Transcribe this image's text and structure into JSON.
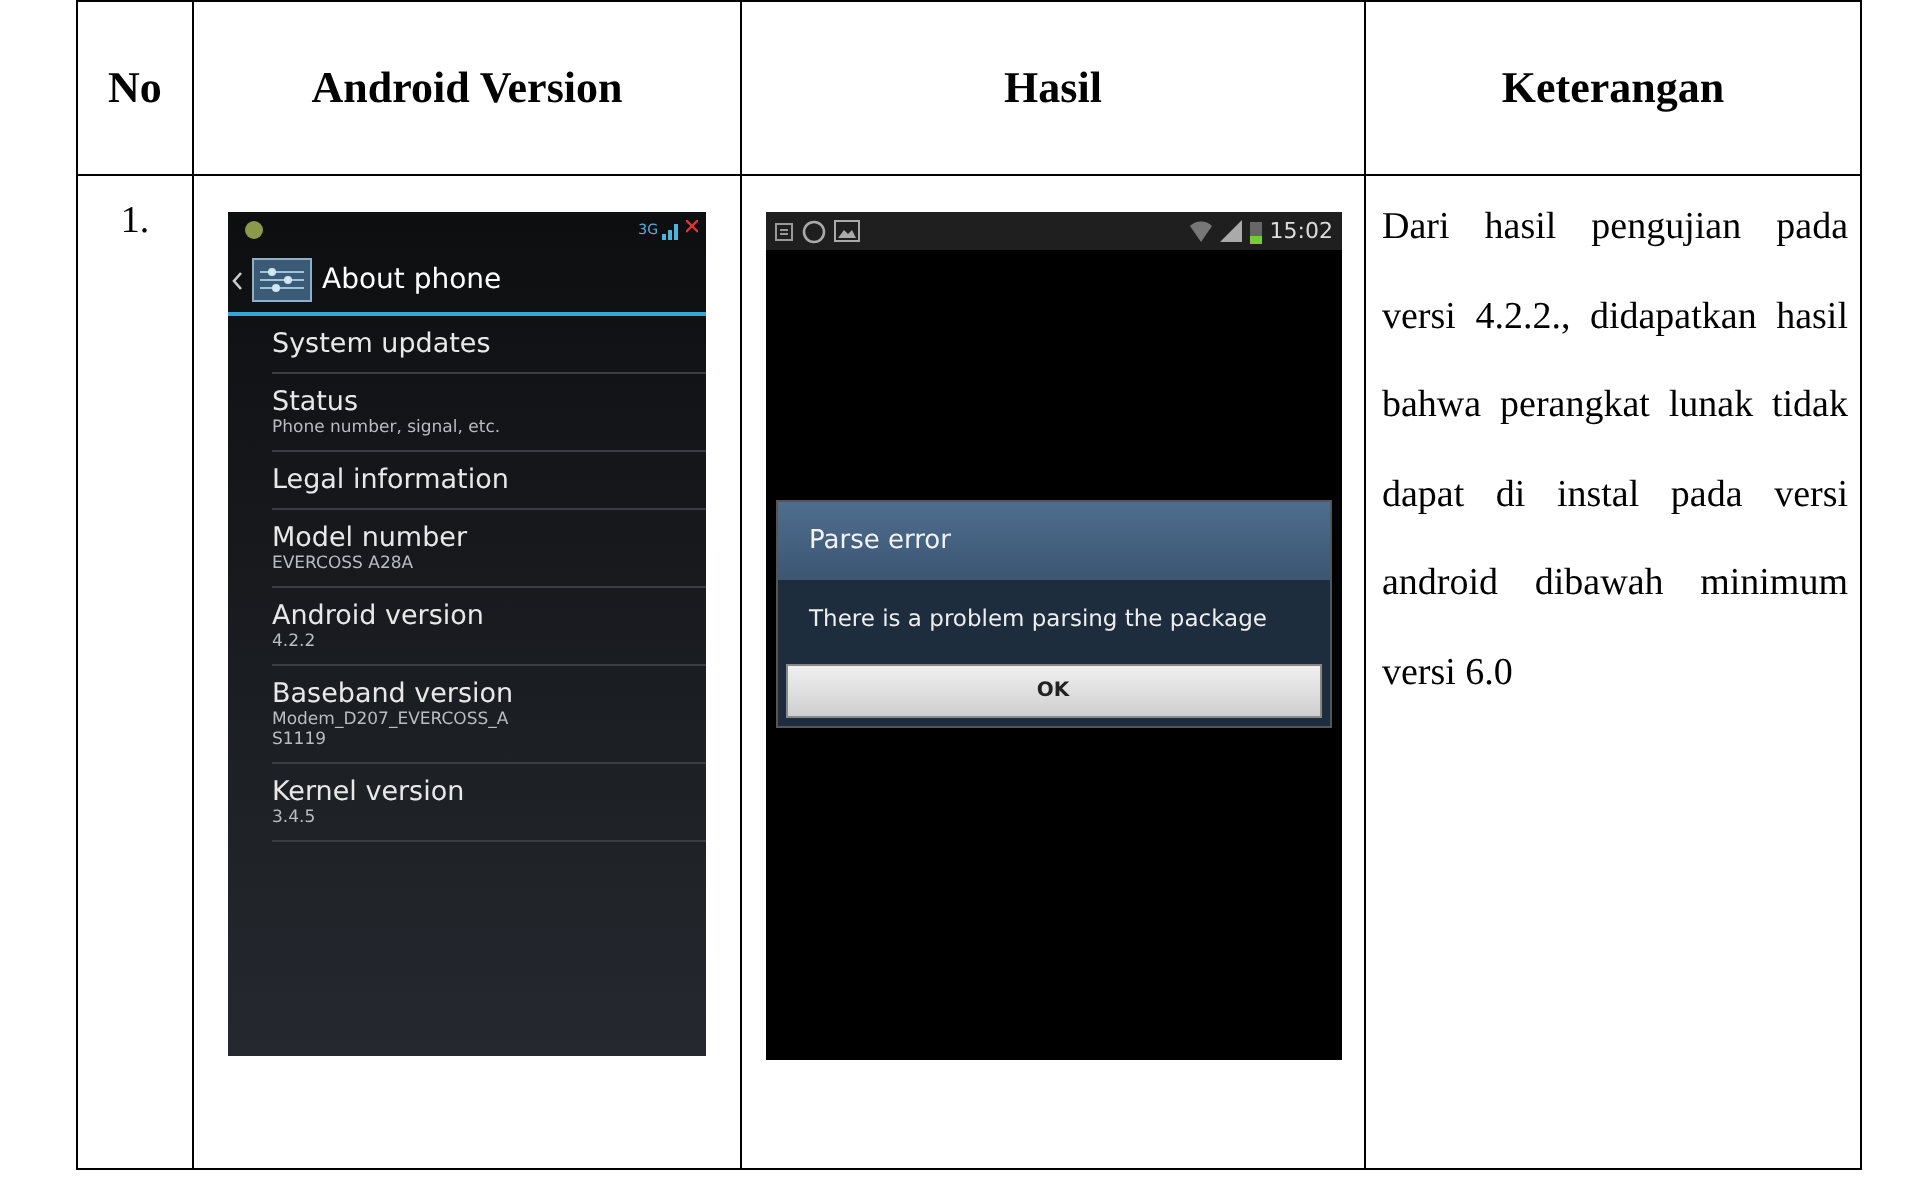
{
  "table": {
    "columns": [
      "No",
      "Android Version",
      "Hasil",
      "Keterangan"
    ],
    "rows": [
      {
        "number": "1.",
        "android_screen": {
          "network": "3G",
          "title": "About phone",
          "items": [
            {
              "title": "System updates"
            },
            {
              "title": "Status",
              "subtitle": "Phone number, signal, etc."
            },
            {
              "title": "Legal information"
            },
            {
              "title": "Model number",
              "subtitle": "EVERCOSS A28A"
            },
            {
              "title": "Android version",
              "subtitle": "4.2.2"
            },
            {
              "title": "Baseband version",
              "subtitle": "Modem_D207_EVERCOSS_A\nS1119"
            },
            {
              "title": "Kernel version",
              "subtitle": "3.4.5"
            }
          ]
        },
        "result_screen": {
          "clock": "15:02",
          "dialog": {
            "title": "Parse error",
            "message": "There is a problem parsing the package",
            "button": "OK"
          }
        },
        "description": "Dari hasil pengujian pada versi 4.2.2., didapatkan hasil bahwa perangkat lunak tidak dapat di instal pada versi android dibawah minimum versi 6.0"
      }
    ]
  }
}
